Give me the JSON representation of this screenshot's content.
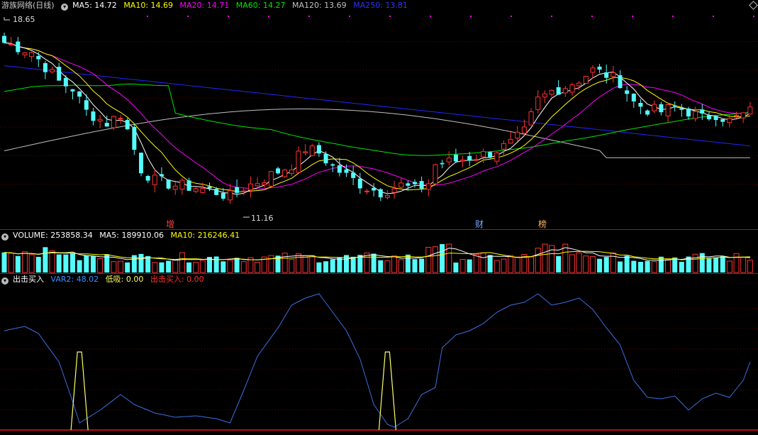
{
  "main_header": {
    "title": "游族网络(日线)",
    "ma5": "MA5: 14.72",
    "ma10": "MA10: 14.69",
    "ma20": "MA20: 14.71",
    "ma60": "MA60: 14.27",
    "ma120": "MA120: 13.69",
    "ma250": "MA250: 13.81"
  },
  "vol_header": {
    "volume": "VOLUME: 253858.34",
    "ma5": "MA5: 189910.06",
    "ma10": "MA10: 216246.41"
  },
  "ind_header": {
    "name": "出击买入",
    "var2": "VAR2: 48.02",
    "dixi": "低吸: 0.00",
    "chuji": "出击买入: 0.00"
  },
  "markers": {
    "zeng": "增",
    "cai": "财",
    "bang": "榜"
  },
  "colors": {
    "up": "#ff3232",
    "down": "#54fcfc",
    "ma5": "#ffffff",
    "ma10": "#ffff00",
    "ma20": "#ff00ff",
    "ma60": "#00e600",
    "ma120": "#c0c0c0",
    "ma250": "#2424ff",
    "var2": "#3a6fe0",
    "dixi": "#ffff66"
  },
  "chart_data": [
    {
      "type": "candlestick",
      "high_label": "18.65",
      "low_label": "11.16",
      "ylim": [
        10.5,
        19.2
      ],
      "n": 110,
      "close_anchors": [
        [
          0,
          17.9
        ],
        [
          4,
          17.5
        ],
        [
          8,
          16.2
        ],
        [
          10,
          15.9
        ],
        [
          12,
          14.9
        ],
        [
          15,
          14.4
        ],
        [
          17,
          14.8
        ],
        [
          18,
          14.1
        ],
        [
          20,
          12.4
        ],
        [
          22,
          11.9
        ],
        [
          25,
          11.7
        ],
        [
          28,
          11.6
        ],
        [
          31,
          11.4
        ],
        [
          33,
          11.2
        ],
        [
          35,
          11.6
        ],
        [
          38,
          12.0
        ],
        [
          42,
          12.6
        ],
        [
          44,
          13.3
        ],
        [
          46,
          13.1
        ],
        [
          48,
          12.5
        ],
        [
          50,
          12.1
        ],
        [
          53,
          11.6
        ],
        [
          55,
          11.4
        ],
        [
          58,
          11.7
        ],
        [
          60,
          11.5
        ],
        [
          62,
          11.8
        ],
        [
          63,
          12.6
        ],
        [
          65,
          12.7
        ],
        [
          68,
          12.9
        ],
        [
          71,
          13.1
        ],
        [
          74,
          13.5
        ],
        [
          76,
          14.0
        ],
        [
          78,
          15.4
        ],
        [
          80,
          15.8
        ],
        [
          82,
          16.0
        ],
        [
          84,
          16.3
        ],
        [
          86,
          16.7
        ],
        [
          88,
          16.5
        ],
        [
          90,
          16.2
        ],
        [
          92,
          15.3
        ],
        [
          94,
          15.0
        ],
        [
          96,
          14.9
        ],
        [
          98,
          15.1
        ],
        [
          100,
          14.9
        ],
        [
          102,
          14.6
        ],
        [
          104,
          14.8
        ],
        [
          106,
          14.5
        ],
        [
          109,
          14.9
        ]
      ],
      "ma_series": [
        "MA5",
        "MA10",
        "MA20",
        "MA60",
        "MA120",
        "MA250"
      ]
    },
    {
      "type": "bar",
      "name": "VOLUME",
      "values": []
    },
    {
      "type": "line",
      "name": "VAR2",
      "ylim": [
        0,
        100
      ],
      "anchors": [
        [
          0,
          70
        ],
        [
          3,
          73
        ],
        [
          5,
          68
        ],
        [
          8,
          48
        ],
        [
          10,
          20
        ],
        [
          11,
          5
        ],
        [
          12,
          8
        ],
        [
          14,
          14
        ],
        [
          17,
          25
        ],
        [
          19,
          18
        ],
        [
          22,
          12
        ],
        [
          25,
          9
        ],
        [
          28,
          10
        ],
        [
          31,
          8
        ],
        [
          33,
          5
        ],
        [
          35,
          28
        ],
        [
          37,
          52
        ],
        [
          40,
          72
        ],
        [
          42,
          88
        ],
        [
          44,
          93
        ],
        [
          46,
          96
        ],
        [
          48,
          83
        ],
        [
          50,
          70
        ],
        [
          52,
          50
        ],
        [
          54,
          18
        ],
        [
          56,
          4
        ],
        [
          57,
          2
        ],
        [
          59,
          8
        ],
        [
          61,
          25
        ],
        [
          63,
          30
        ],
        [
          64,
          58
        ],
        [
          66,
          67
        ],
        [
          68,
          70
        ],
        [
          70,
          75
        ],
        [
          72,
          83
        ],
        [
          74,
          88
        ],
        [
          76,
          90
        ],
        [
          78,
          96
        ],
        [
          80,
          88
        ],
        [
          82,
          90
        ],
        [
          84,
          93
        ],
        [
          86,
          85
        ],
        [
          88,
          72
        ],
        [
          90,
          60
        ],
        [
          92,
          35
        ],
        [
          94,
          23
        ],
        [
          96,
          22
        ],
        [
          98,
          24
        ],
        [
          100,
          14
        ],
        [
          102,
          22
        ],
        [
          104,
          26
        ],
        [
          106,
          23
        ],
        [
          108,
          35
        ],
        [
          109,
          48
        ]
      ]
    },
    {
      "type": "line",
      "name": "低吸",
      "spikes": [
        11,
        56
      ],
      "spike_value": 55
    }
  ]
}
